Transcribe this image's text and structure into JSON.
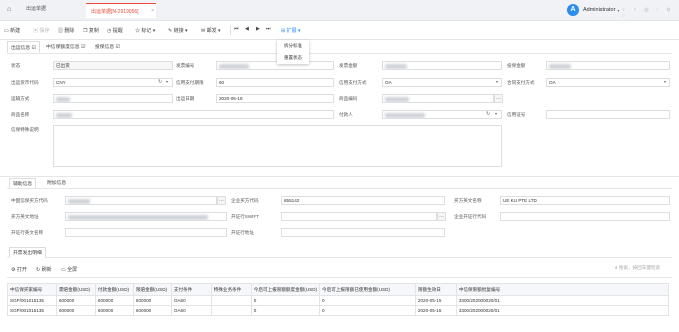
{
  "topbar": {
    "tab_list": "出运单据",
    "tab_active": "出运单据[N-2919056]",
    "tab_close": "×",
    "avatar_letter": "A",
    "user_name": "Administrator",
    "user_caret": "▾",
    "right_icons": "♀ ♀ ◎ ◌ ⊙ ◌"
  },
  "toolbar": {
    "new": "新建",
    "save": "保存",
    "delete": "删除",
    "copy": "复制",
    "remind": "提醒",
    "tag": "标记",
    "link": "链接",
    "mail": "邮发",
    "extend": "扩展",
    "first": "⏮",
    "prev": "◀",
    "next": "▶",
    "last": "⏭"
  },
  "dropdown": {
    "items": [
      "拆分标准",
      "重置状态"
    ]
  },
  "sections": {
    "tabs": [
      "出运信息",
      "中信保额度信息",
      "投保信息"
    ],
    "check": "☑"
  },
  "form": {
    "status_label": "状态",
    "status_value": "已出货",
    "invoice_label": "发票编号",
    "invoice_amount_label": "发票金额",
    "insured_amount_label": "投保金额",
    "currency_label": "出运货币代码",
    "currency_value": "CNY",
    "credit_days_label": "信用支付期限",
    "credit_days_value": "60",
    "pay_method_label": "信用支付方式",
    "pay_method_value": "OA",
    "contract_pay_label": "合同支付方式",
    "contract_pay_value": "OA",
    "transport_label": "运输方式",
    "ship_date_label": "出运日期",
    "ship_date_value": "2020-05-18",
    "hs_code_label": "商品编码",
    "goods_label": "商品名称",
    "payer_label": "付款人",
    "credit_no_label": "信用证号",
    "remarks_label": "信保特殊说明"
  },
  "bottom_tabs": {
    "tab1": "辅助信息",
    "tab2": "附加信息"
  },
  "aux": {
    "buyer_code_label": "中国信保买方代码",
    "buyer_code2_label": "企业买方代码",
    "buyer_code2_value": "855142",
    "buyer_name_label": "买方英文名称",
    "buyer_name_value": "UE KU PTE LTD",
    "buyer_addr_label": "买方英文地址",
    "bank_swift_label": "开证行SWIFT",
    "bank_code_label": "企业开证行代码",
    "bank_name_label": "开证行英文名称",
    "bank_addr_label": "开证行地址"
  },
  "subtab": "开票发出明细",
  "grid_toolbar": {
    "open": "打开",
    "refresh": "刷新",
    "fullscreen": "全屏",
    "search_placeholder": "搜索，按回车键检索"
  },
  "table": {
    "headers": [
      "中信保买家编号",
      "需赔金额(USD)",
      "付款金额(USD)",
      "限赔金额(USD)",
      "支付条件",
      "特殊业务条件",
      "今后可上报限额额度金额(USD)",
      "今后可上报限额已使用金额(USD)",
      "限额生效日",
      "中信保限额批复编号"
    ],
    "rows": [
      [
        "SGP/001015135",
        "600000",
        "600000",
        "600000",
        "OA60",
        "",
        "0",
        "0",
        "2020-05-15",
        "3300/202000020/01"
      ],
      [
        "SGP/001015135",
        "600000",
        "600000",
        "600000",
        "OA60",
        "",
        "0",
        "0",
        "2020-05-15",
        "3300/202000020/01"
      ]
    ]
  },
  "colors": {
    "accent": "#2d8cf0",
    "active_tab": "#e74c3c"
  }
}
